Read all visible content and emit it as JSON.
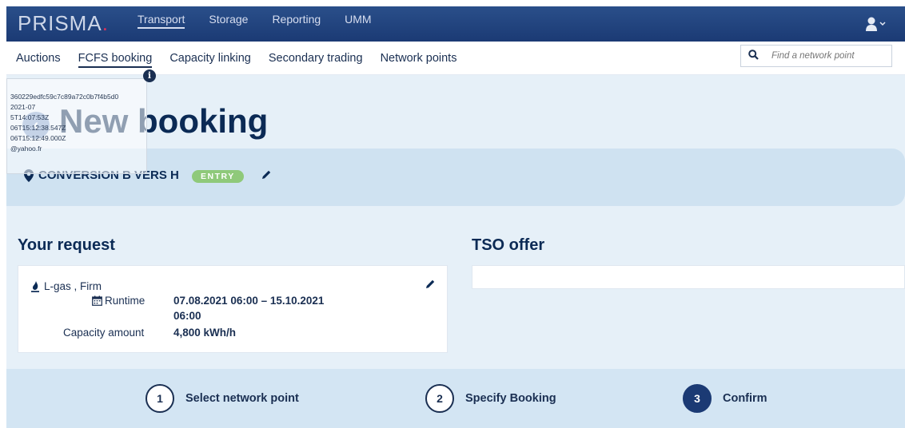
{
  "app": {
    "brand_name": "PRISMA",
    "brand_dot": ".",
    "top_nav": [
      {
        "label": "Transport",
        "active": true
      },
      {
        "label": "Storage",
        "active": false
      },
      {
        "label": "Reporting",
        "active": false
      },
      {
        "label": "UMM",
        "active": false
      }
    ]
  },
  "sub_nav": {
    "items": [
      {
        "label": "Auctions",
        "active": false
      },
      {
        "label": "FCFS booking",
        "active": true
      },
      {
        "label": "Capacity linking",
        "active": false
      },
      {
        "label": "Secondary trading",
        "active": false
      },
      {
        "label": "Network points",
        "active": false
      }
    ],
    "search_placeholder": "Find a network point",
    "search_icon": "search-icon"
  },
  "debug_overlay": {
    "lines": [
      "360229edfc59c7c89a72c0b7f4b5d0",
      "2021-07",
      "5T14:07:53Z",
      "",
      "06T15:12:38.547Z",
      "06T15:12:49.000Z",
      "@yahoo.fr"
    ]
  },
  "page": {
    "title": "New booking",
    "network_point": "CONVERSION B VERS H",
    "direction_badge": "ENTRY"
  },
  "request": {
    "heading": "Your request",
    "gas_type": "L-gas , Firm",
    "runtime_label": "Runtime",
    "runtime_value_1": "07.08.2021 06:00 – 15.10.2021",
    "runtime_value_2": "06:00",
    "capacity_label": "Capacity amount",
    "capacity_value": "4,800 kWh/h"
  },
  "offer": {
    "heading": "TSO offer"
  },
  "steps": [
    {
      "number": "1",
      "label": "Select network point",
      "current": false
    },
    {
      "number": "2",
      "label": "Specify Booking",
      "current": false
    },
    {
      "number": "3",
      "label": "Confirm",
      "current": true
    }
  ],
  "colors": {
    "header": "#1b3a74",
    "accent_badge": "#8fc97a",
    "background": "#e6f0f8",
    "brand_dot": "#e0315a"
  }
}
